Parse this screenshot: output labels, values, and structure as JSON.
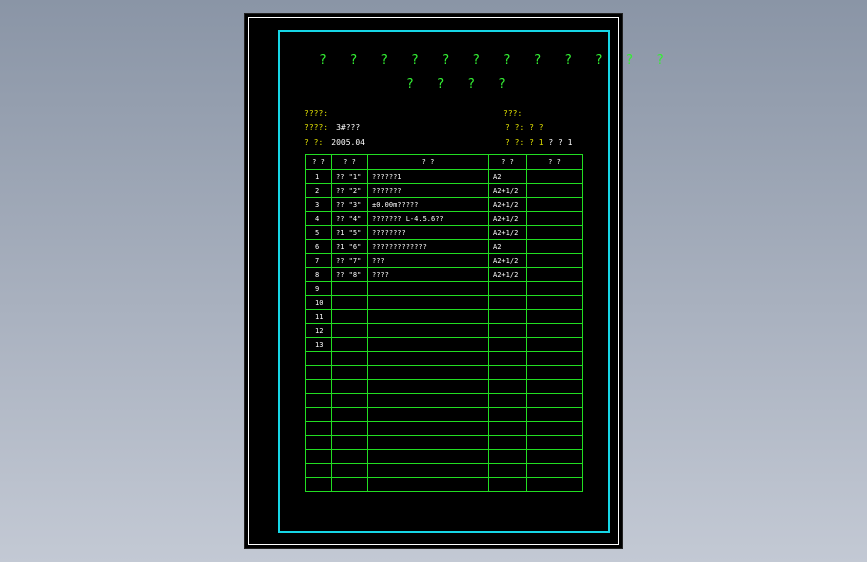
{
  "title_line1": "? ? ? ? ? ? ? ? ? ? ? ?",
  "title_line2": "? ? ? ?",
  "info_left": [
    {
      "label": "????:",
      "value": ""
    },
    {
      "label": "????:",
      "value": "3#???"
    },
    {
      "label": "?  ?:",
      "value": "2005.04"
    }
  ],
  "info_right": [
    {
      "label": "???:",
      "value": ""
    },
    {
      "label": "? ?: ? ?",
      "value": ""
    },
    {
      "label": "? ?: ? 1",
      "value": "? ? 1"
    }
  ],
  "table": {
    "headers": [
      "? ?",
      "? ?",
      "?          ?",
      "? ?",
      "? ?"
    ],
    "rows": [
      [
        "1",
        "?? \"1\"",
        "??????1",
        "A2",
        ""
      ],
      [
        "2",
        "?? \"2\"",
        "???????",
        "A2+1/2",
        ""
      ],
      [
        "3",
        "?? \"3\"",
        "±0.00m?????",
        "A2+1/2",
        ""
      ],
      [
        "4",
        "?? \"4\"",
        "???????   L-4.5.6??",
        "A2+1/2",
        ""
      ],
      [
        "5",
        "?1 \"5\"",
        "????????",
        "A2+1/2",
        ""
      ],
      [
        "6",
        "?1 \"6\"",
        "?????????????",
        "A2",
        ""
      ],
      [
        "7",
        "?? \"7\"",
        "???",
        "A2+1/2",
        ""
      ],
      [
        "8",
        "?? \"8\"",
        "????",
        "A2+1/2",
        ""
      ],
      [
        "9",
        "",
        "",
        "",
        ""
      ],
      [
        "10",
        "",
        "",
        "",
        ""
      ],
      [
        "11",
        "",
        "",
        "",
        ""
      ],
      [
        "12",
        "",
        "",
        "",
        ""
      ],
      [
        "13",
        "",
        "",
        "",
        ""
      ],
      [
        "",
        "",
        "",
        "",
        ""
      ],
      [
        "",
        "",
        "",
        "",
        ""
      ],
      [
        "",
        "",
        "",
        "",
        ""
      ],
      [
        "",
        "",
        "",
        "",
        ""
      ],
      [
        "",
        "",
        "",
        "",
        ""
      ],
      [
        "",
        "",
        "",
        "",
        ""
      ],
      [
        "",
        "",
        "",
        "",
        ""
      ],
      [
        "",
        "",
        "",
        "",
        ""
      ],
      [
        "",
        "",
        "",
        "",
        ""
      ],
      [
        "",
        "",
        "",
        "",
        ""
      ]
    ]
  },
  "colors": {
    "background": "#000000",
    "frame": "#16d6e6",
    "grid": "#22dd22",
    "title": "#33ee33",
    "label": "#e0e000"
  }
}
